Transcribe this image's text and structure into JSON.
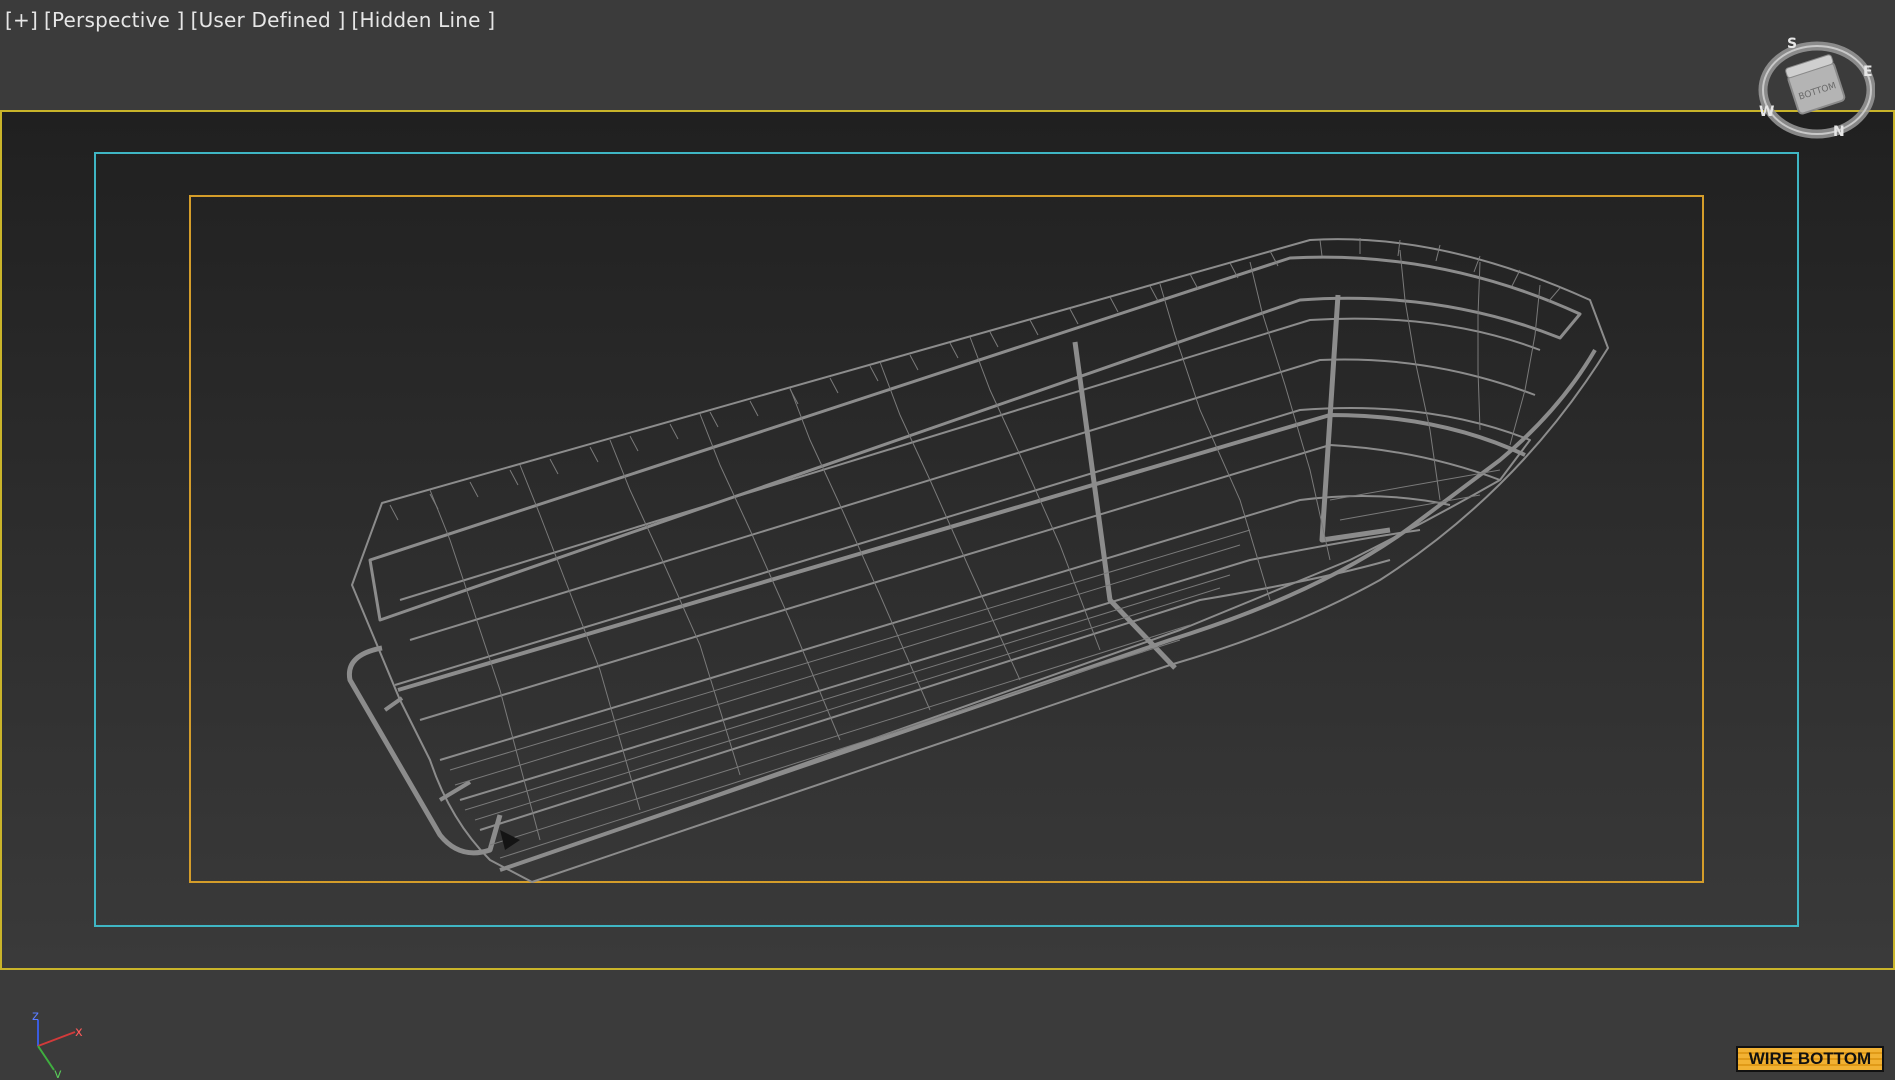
{
  "viewport": {
    "labels": [
      "[+]",
      "[Perspective ]",
      "[User Defined ]",
      "[Hidden Line ]"
    ]
  },
  "viewcube": {
    "directions": {
      "n": "N",
      "s": "S",
      "e": "E",
      "w": "W"
    },
    "face_label": "BOTTOM"
  },
  "axis_tripod": {
    "x": "x",
    "y": "y",
    "z": "z"
  },
  "badge": {
    "label": "WIRE BOTTOM"
  },
  "colors": {
    "render_frame": "#c9b42a",
    "action_safe_frame": "#3fb6c4",
    "title_safe_frame": "#d49d2a",
    "wireframe": "#8c8c8c",
    "badge": "#f2b233"
  },
  "icons": {
    "viewcube": "viewcube-icon",
    "tripod": "axis-tripod-icon"
  }
}
